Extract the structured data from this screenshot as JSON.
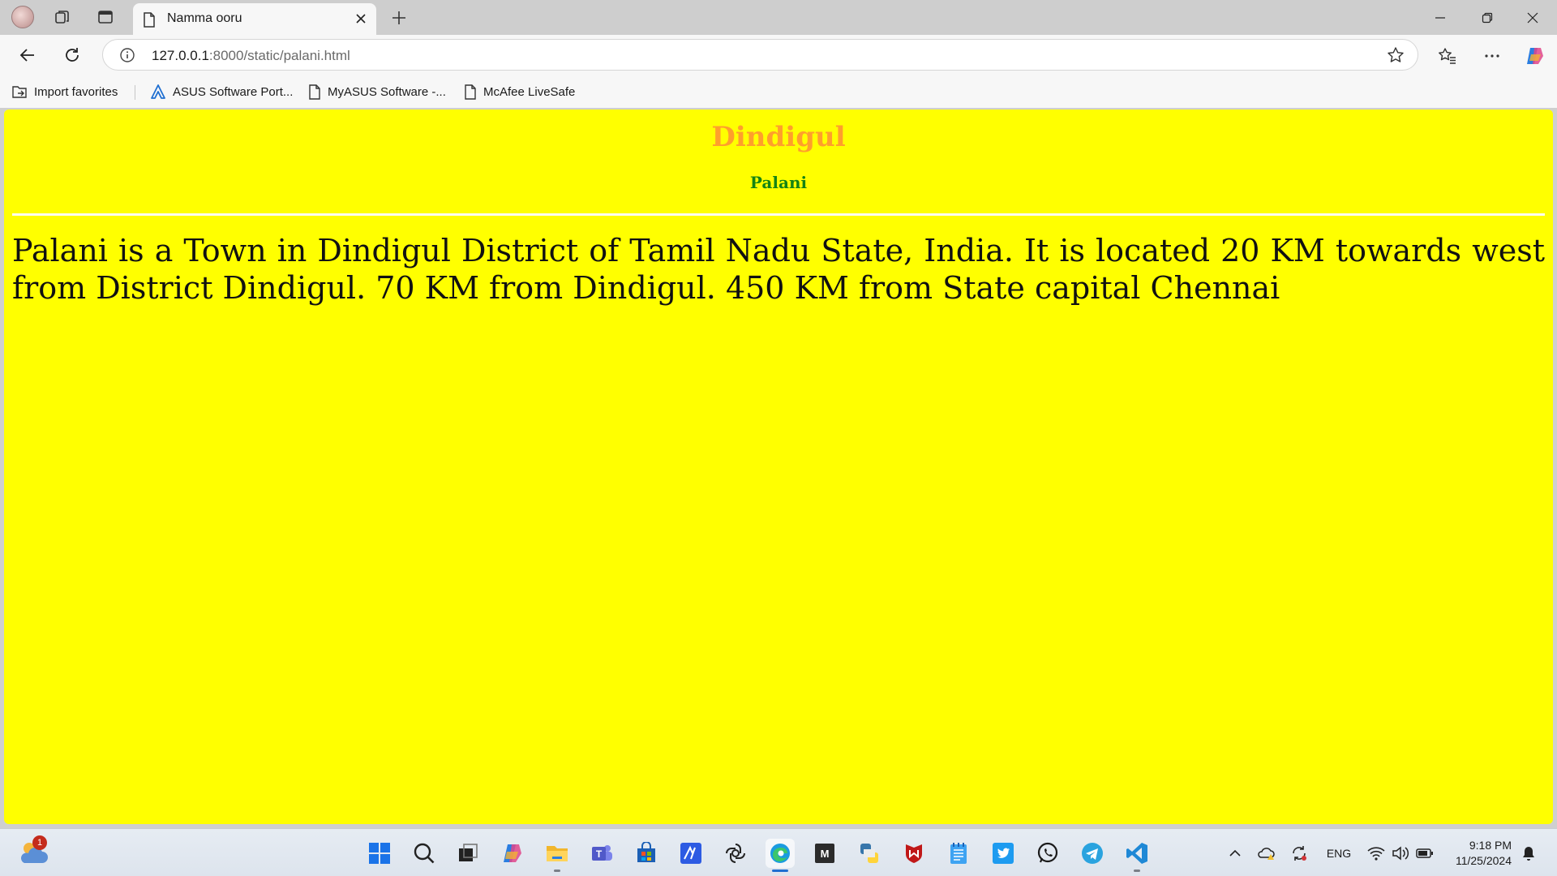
{
  "browser": {
    "tab": {
      "title": "Namma ooru"
    },
    "address_bar": {
      "url_host": "127.0.0.1",
      "url_rest": ":8000/static/palani.html"
    },
    "favorites_bar": [
      {
        "label": "Import favorites",
        "icon": "import-favorites-icon"
      },
      {
        "label": "ASUS Software Port...",
        "icon": "asus-logo-icon"
      },
      {
        "label": "MyASUS Software -...",
        "icon": "page-icon"
      },
      {
        "label": "McAfee LiveSafe",
        "icon": "page-icon"
      }
    ]
  },
  "page": {
    "background_color": "#ffff00",
    "heading": "Dindigul",
    "heading_color": "#ff9f2c",
    "subheading": "Palani",
    "subheading_color": "#148314",
    "paragraph": "Palani is a Town in Dindigul District of Tamil Nadu State, India. It is located 20 KM towards west from District Dindigul. 70 KM from Dindigul. 450 KM from State capital Chennai"
  },
  "taskbar": {
    "weather_badge": "1",
    "apps": [
      "start-icon",
      "search-icon",
      "task-view-icon",
      "copilot-icon",
      "file-explorer-icon",
      "teams-icon",
      "microsoft-store-icon",
      "code-editor-icon",
      "chatgpt-icon",
      "edge-icon",
      "m-app-icon",
      "python-icon",
      "mcafee-icon",
      "notepad-icon",
      "twitter-icon",
      "whatsapp-icon",
      "telegram-icon",
      "vscode-icon"
    ],
    "tray": {
      "language": "ENG"
    },
    "clock": {
      "time": "9:18 PM",
      "date": "11/25/2024"
    }
  }
}
